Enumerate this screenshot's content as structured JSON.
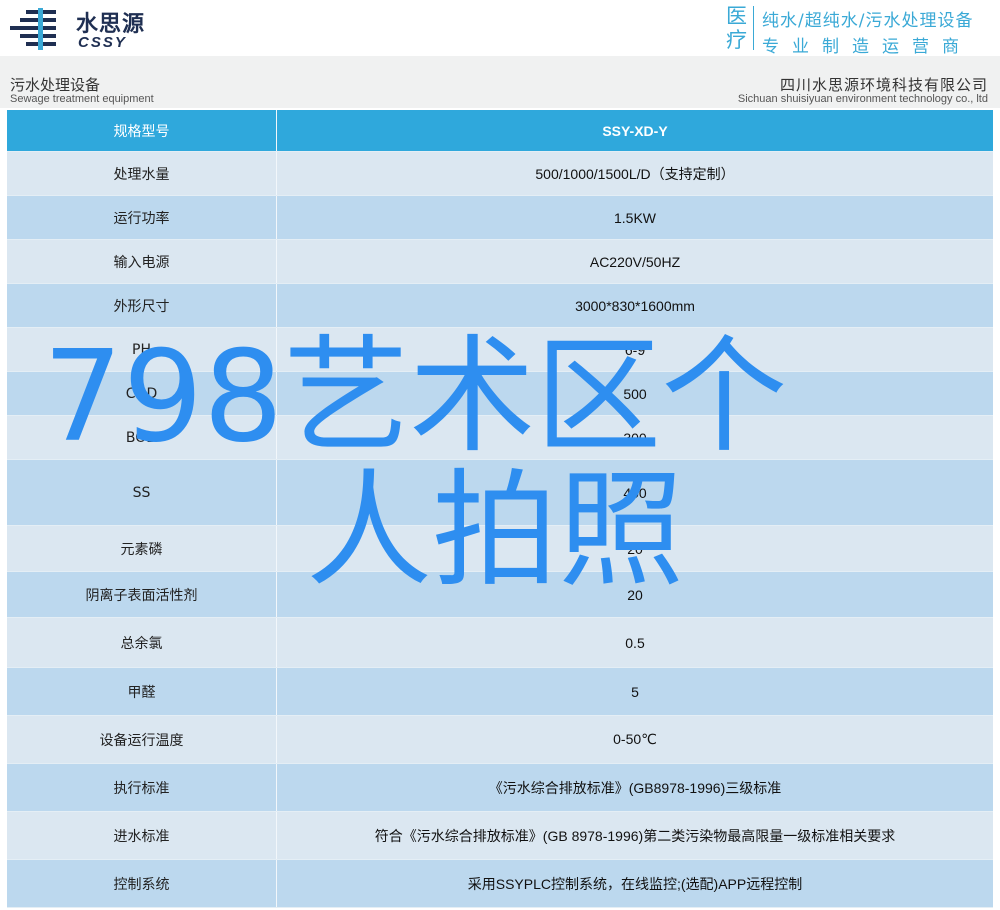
{
  "brand": {
    "name_cn": "水思源",
    "name_en": "CSSY",
    "tag_big": [
      "医",
      "疗"
    ],
    "tag_line1": "纯水/超纯水/污水处理设备",
    "tag_line2": "专业制造运营商",
    "accent": "#3aa9d6"
  },
  "subheader": {
    "left_cn": "污水处理设备",
    "left_en": "Sewage treatment equipment",
    "right_cn": "四川水思源环境科技有限公司",
    "right_en": "Sichuan shuisiyuan environment technology co., ltd"
  },
  "table": {
    "header": {
      "label": "规格型号",
      "value": "SSY-XD-Y"
    },
    "rows": [
      {
        "label": "处理水量",
        "value": "500/1000/1500L/D（支持定制）"
      },
      {
        "label": "运行功率",
        "value": "1.5KW"
      },
      {
        "label": "输入电源",
        "value": "AC220V/50HZ"
      },
      {
        "label": "外形尺寸",
        "value": "3000*830*1600mm"
      },
      {
        "label": "PH",
        "value": "6-9"
      },
      {
        "label": "COD",
        "value": "500"
      },
      {
        "label": "BOD",
        "value": "300"
      },
      {
        "label": "SS",
        "value": "400"
      },
      {
        "label": "元素磷",
        "value": "20"
      },
      {
        "label": "阴离子表面活性剂",
        "value": "20"
      },
      {
        "label": "总余氯",
        "value": "0.5"
      },
      {
        "label": "甲醛",
        "value": "5"
      },
      {
        "label": "设备运行温度",
        "value": "0-50℃"
      },
      {
        "label": "执行标准",
        "value": "《污水综合排放标准》(GB8978-1996)三级标准"
      },
      {
        "label": "进水标准",
        "value": "符合《污水综合排放标准》(GB 8978-1996)第二类污染物最高限量一级标准相关要求"
      },
      {
        "label": "控制系统",
        "value": "采用SSYPLC控制系统，在线监控;(选配)APP远程控制"
      }
    ],
    "colors": {
      "header": "#2fa8dc",
      "alt": "#bcd8ee",
      "normal": "#dbe7f1"
    }
  },
  "overlay": {
    "line1": "798艺术区个",
    "line2": "人拍照",
    "color": "#2e8ef0"
  }
}
